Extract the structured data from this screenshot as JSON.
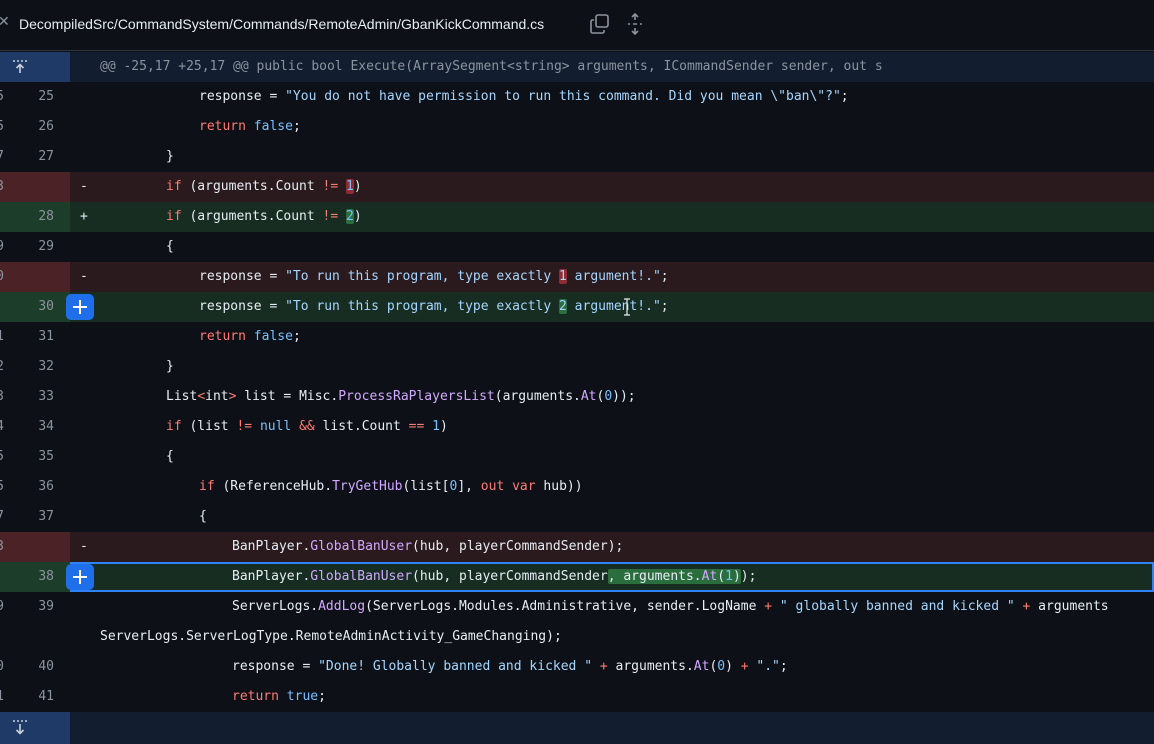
{
  "header": {
    "file_path": "DecompiledSrc/CommandSystem/Commands/RemoteAdmin/GbanKickCommand.cs",
    "icons": [
      "collapse-chevron-icon",
      "copy-icon",
      "expand-all-icon"
    ]
  },
  "hunk": {
    "text": "@@ -25,17 +25,17 @@ public bool Execute(ArraySegment<string> arguments, ICommandSender sender, out s"
  },
  "lines": [
    {
      "old": "5",
      "new": "25",
      "sign": "",
      "type": "ctx"
    },
    {
      "old": "5",
      "new": "26",
      "sign": "",
      "type": "ctx"
    },
    {
      "old": "7",
      "new": "27",
      "sign": "",
      "type": "ctx"
    },
    {
      "old": "3",
      "new": "",
      "sign": "-",
      "type": "del"
    },
    {
      "old": "",
      "new": "28",
      "sign": "+",
      "type": "add"
    },
    {
      "old": "9",
      "new": "29",
      "sign": "",
      "type": "ctx"
    },
    {
      "old": "0",
      "new": "",
      "sign": "-",
      "type": "del"
    },
    {
      "old": "",
      "new": "30",
      "sign": "",
      "type": "add"
    },
    {
      "old": "1",
      "new": "31",
      "sign": "",
      "type": "ctx"
    },
    {
      "old": "2",
      "new": "32",
      "sign": "",
      "type": "ctx"
    },
    {
      "old": "3",
      "new": "33",
      "sign": "",
      "type": "ctx"
    },
    {
      "old": "4",
      "new": "34",
      "sign": "",
      "type": "ctx"
    },
    {
      "old": "5",
      "new": "35",
      "sign": "",
      "type": "ctx"
    },
    {
      "old": "5",
      "new": "36",
      "sign": "",
      "type": "ctx"
    },
    {
      "old": "7",
      "new": "37",
      "sign": "",
      "type": "ctx"
    },
    {
      "old": "3",
      "new": "",
      "sign": "-",
      "type": "del"
    },
    {
      "old": "",
      "new": "38",
      "sign": "",
      "type": "add"
    },
    {
      "old": "9",
      "new": "39",
      "sign": "",
      "type": "ctx"
    },
    {
      "old": "",
      "new": "",
      "sign": "",
      "type": "ctx"
    },
    {
      "old": "0",
      "new": "40",
      "sign": "",
      "type": "ctx"
    },
    {
      "old": "1",
      "new": "41",
      "sign": "",
      "type": "ctx"
    }
  ],
  "code": {
    "l25_a": "response = ",
    "l25_b": "\"You do not have permission to run this command. Did you mean \\\"ban\\\"?\"",
    "l25_c": ";",
    "l26_kw": "return",
    "l26_v": "false",
    "l26_c": ";",
    "l27": "}",
    "d28_kw": "if",
    "d28_a": " (arguments.Count ",
    "d28_op": "!=",
    "d28_sp": " ",
    "d28_n": "1",
    "d28_c": ")",
    "a28_kw": "if",
    "a28_a": " (arguments.Count ",
    "a28_op": "!=",
    "a28_sp": " ",
    "a28_n": "2",
    "a28_c": ")",
    "l29": "{",
    "d30_a": "response = ",
    "d30_s1": "\"To run this program, type exactly ",
    "d30_n": "1",
    "d30_s2": " argument!.\"",
    "d30_c": ";",
    "a30_a": "response = ",
    "a30_s1": "\"To run this program, type exactly ",
    "a30_n": "2",
    "a30_s2": " argument!.\"",
    "a30_c": ";",
    "l31_kw": "return",
    "l31_v": "false",
    "l31_c": ";",
    "l32": "}",
    "l33_a": "List",
    "l33_lt": "<",
    "l33_t": "int",
    "l33_gt": ">",
    "l33_b": " list = Misc.",
    "l33_fn": "ProcessRaPlayersList",
    "l33_c": "(arguments.",
    "l33_fn2": "At",
    "l33_d": "(",
    "l33_n": "0",
    "l33_e": "));",
    "l34_kw": "if",
    "l34_a": " (list ",
    "l34_op": "!=",
    "l34_sp": " ",
    "l34_null": "null",
    "l34_sp2": " ",
    "l34_and": "&&",
    "l34_b": " list.Count ",
    "l34_eq": "==",
    "l34_sp3": " ",
    "l34_n": "1",
    "l34_c": ")",
    "l35": "{",
    "l36_kw": "if",
    "l36_a": " (ReferenceHub.",
    "l36_fn": "TryGetHub",
    "l36_b": "(list[",
    "l36_n": "0",
    "l36_c": "], ",
    "l36_out": "out",
    "l36_sp": " ",
    "l36_var": "var",
    "l36_d": " hub))",
    "l37": "{",
    "d38_a": "BanPlayer.",
    "d38_fn": "GlobalBanUser",
    "d38_b": "(hub, playerCommandSender);",
    "a38_a": "BanPlayer.",
    "a38_fn": "GlobalBanUser",
    "a38_b": "(hub, playerCommandSender",
    "a38_hl_a": ", arguments.",
    "a38_hl_fn": "At",
    "a38_hl_b": "(",
    "a38_hl_n": "1",
    "a38_hl_c": ")",
    "a38_c": ");",
    "l39_a": "ServerLogs.",
    "l39_fn": "AddLog",
    "l39_b": "(ServerLogs.Modules.Administrative, sender.LogName ",
    "l39_op": "+",
    "l39_sp": " ",
    "l39_s": "\" globally banned and kicked \"",
    "l39_sp2": " ",
    "l39_op2": "+",
    "l39_c": " arguments",
    "l39w": "ServerLogs.ServerLogType.RemoteAdminActivity_GameChanging);",
    "l40_a": "response = ",
    "l40_s": "\"Done! Globally banned and kicked \"",
    "l40_sp": " ",
    "l40_op": "+",
    "l40_b": " arguments.",
    "l40_fn": "At",
    "l40_c": "(",
    "l40_n": "0",
    "l40_d": ") ",
    "l40_op2": "+",
    "l40_sp2": " ",
    "l40_s2": "\".\"",
    "l40_e": ";",
    "l41_kw": "return",
    "l41_v": "true",
    "l41_c": ";"
  },
  "colors": {
    "background": "#0d1117",
    "deleted_row": "#2a1a1e",
    "added_row": "#172d22",
    "hunk_gutter": "#1f3a66",
    "accent": "#1f6feb"
  }
}
